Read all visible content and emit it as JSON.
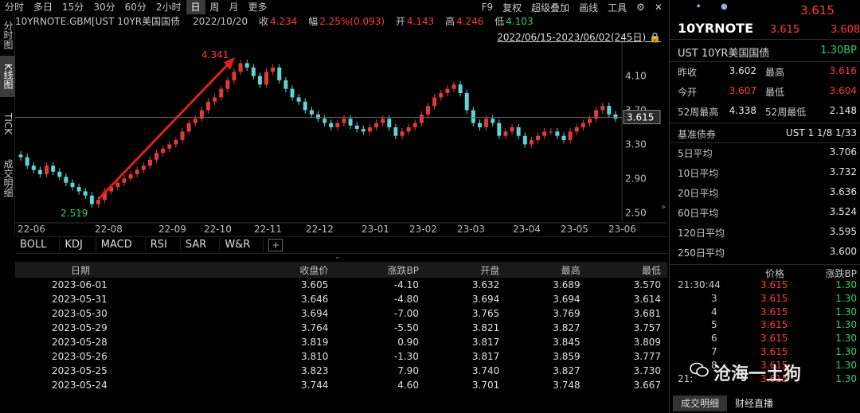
{
  "toolbar": {
    "tabs": [
      "分时",
      "多日",
      "15分",
      "30分",
      "60分",
      "2小时",
      "日",
      "周",
      "月",
      "更多"
    ],
    "active": "日",
    "right": [
      "F9",
      "复权",
      "超级叠加",
      "画线",
      "工具"
    ]
  },
  "vtabs": [
    "分时图",
    "K线图",
    "TICK",
    "成交明细"
  ],
  "quote": {
    "name": "10YRNOTE.GBM[UST 10YR美国国债",
    "date": "2022/10/20",
    "close_label": "收",
    "close": "4.234",
    "change_label": "幅",
    "change": "2.25%(0.093)",
    "open_label": "开",
    "open": "4.143",
    "high_label": "高",
    "high": "4.246",
    "low_label": "低",
    "low": "4.103"
  },
  "date_range": "2022/06/15-2023/06/02(245日)",
  "chart_data": {
    "type": "candlestick",
    "y_ticks": [
      "4.10",
      "3.70",
      "3.30",
      "2.90",
      "2.50"
    ],
    "y_tick_values": [
      4.1,
      3.7,
      3.3,
      2.9,
      2.5
    ],
    "ylim": [
      2.4,
      4.45
    ],
    "x_ticks": [
      "22-06",
      "22-08",
      "22-09",
      "22-10",
      "22-11",
      "22-12",
      "23-01",
      "23-02",
      "23-03",
      "23-04",
      "23-05",
      "23-06"
    ],
    "annotations": {
      "high": "4.341",
      "low": "2.519"
    },
    "current_price": "3.615",
    "series_close": [
      3.15,
      3.05,
      3.0,
      2.95,
      3.05,
      2.98,
      2.92,
      2.85,
      2.8,
      2.75,
      2.7,
      2.6,
      2.65,
      2.75,
      2.8,
      2.85,
      2.9,
      2.95,
      3.0,
      3.05,
      3.12,
      3.2,
      3.25,
      3.3,
      3.35,
      3.45,
      3.55,
      3.6,
      3.7,
      3.8,
      3.85,
      3.95,
      4.05,
      4.15,
      4.25,
      4.2,
      4.1,
      4.0,
      4.15,
      4.2,
      4.05,
      3.95,
      3.85,
      3.8,
      3.7,
      3.65,
      3.6,
      3.55,
      3.5,
      3.55,
      3.6,
      3.52,
      3.48,
      3.45,
      3.5,
      3.55,
      3.6,
      3.5,
      3.4,
      3.45,
      3.5,
      3.55,
      3.65,
      3.75,
      3.85,
      3.9,
      3.95,
      4.0,
      3.9,
      3.7,
      3.55,
      3.5,
      3.6,
      3.55,
      3.4,
      3.45,
      3.5,
      3.4,
      3.3,
      3.35,
      3.4,
      3.45,
      3.45,
      3.4,
      3.35,
      3.45,
      3.5,
      3.55,
      3.6,
      3.7,
      3.75,
      3.65,
      3.6
    ]
  },
  "indicator_tabs": [
    "BOLL",
    "KDJ",
    "MACD",
    "RSI",
    "SAR",
    "W&R"
  ],
  "table": {
    "headers": [
      "日期",
      "收盘价",
      "涨跌BP",
      "开盘",
      "最高",
      "最低"
    ],
    "rows": [
      [
        "2023-06-01",
        "3.605",
        "-4.10",
        "3.632",
        "3.689",
        "3.570"
      ],
      [
        "2023-05-31",
        "3.646",
        "-4.80",
        "3.694",
        "3.694",
        "3.614"
      ],
      [
        "2023-05-30",
        "3.694",
        "-7.00",
        "3.765",
        "3.769",
        "3.681"
      ],
      [
        "2023-05-29",
        "3.764",
        "-5.50",
        "3.821",
        "3.827",
        "3.757"
      ],
      [
        "2023-05-28",
        "3.819",
        "0.90",
        "3.817",
        "3.845",
        "3.809"
      ],
      [
        "2023-05-26",
        "3.810",
        "-1.30",
        "3.817",
        "3.859",
        "3.777"
      ],
      [
        "2023-05-25",
        "3.823",
        "7.90",
        "3.740",
        "3.827",
        "3.730"
      ],
      [
        "2023-05-24",
        "3.744",
        "4.60",
        "3.701",
        "3.748",
        "3.667"
      ]
    ]
  },
  "right": {
    "top_price": "3.615",
    "symbol": "10YRNOTE",
    "bid": "3.615",
    "ask": "3.608",
    "name": "UST 10YR美国国债",
    "bp": "1.30BP",
    "stats": [
      {
        "l1": "昨收",
        "v1": "3.602",
        "c1": "white",
        "l2": "最高",
        "v2": "3.616",
        "c2": "red"
      },
      {
        "l1": "今开",
        "v1": "3.607",
        "c1": "red",
        "l2": "最低",
        "v2": "3.604",
        "c2": "red"
      },
      {
        "l1": "52周最高",
        "v1": "4.338",
        "c1": "white",
        "l2": "52周最低",
        "v2": "2.148",
        "c2": "white"
      }
    ],
    "bench_label": "基准债券",
    "bench_value": "UST 1 1/8 1/33",
    "averages": [
      {
        "label": "5日平均",
        "value": "3.706"
      },
      {
        "label": "10日平均",
        "value": "3.732"
      },
      {
        "label": "20日平均",
        "value": "3.636"
      },
      {
        "label": "60日平均",
        "value": "3.524"
      },
      {
        "label": "120日平均",
        "value": "3.595"
      },
      {
        "label": "250日平均",
        "value": "3.600"
      }
    ],
    "tick_headers": [
      "价格",
      "涨跌BP"
    ],
    "ticks": [
      {
        "t": "21:30:44",
        "p": "3.615",
        "c": "1.30"
      },
      {
        "t": "3",
        "p": "3.615",
        "c": "1.30"
      },
      {
        "t": "4",
        "p": "3.615",
        "c": "1.30"
      },
      {
        "t": "5",
        "p": "3.615",
        "c": "1.30"
      },
      {
        "t": "6",
        "p": "3.615",
        "c": "1.30"
      },
      {
        "t": "7",
        "p": "3.615",
        "c": "1.30"
      },
      {
        "t": "8",
        "p": "3.615",
        "c": "1.30"
      },
      {
        "t": "21:",
        "p": "3.615",
        "c": "1.30"
      }
    ],
    "bottom_tabs": [
      "成交明细",
      "财经直播"
    ]
  },
  "watermark": "沧海一土狗"
}
